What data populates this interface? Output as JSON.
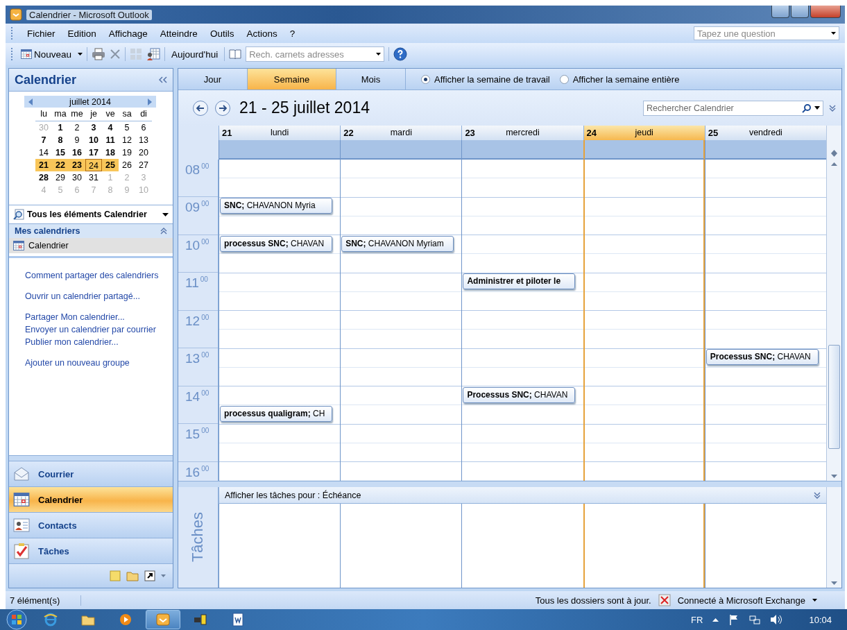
{
  "window": {
    "title": "Calendrier - Microsoft Outlook"
  },
  "menu": [
    "Fichier",
    "Edition",
    "Affichage",
    "Atteindre",
    "Outils",
    "Actions",
    "?"
  ],
  "help_box": {
    "placeholder": "Tapez une question"
  },
  "toolbar": {
    "new_label": "Nouveau",
    "today_label": "Aujourd'hui",
    "address_search": {
      "placeholder": "Rech. carnets adresses"
    }
  },
  "sidebar": {
    "title": "Calendrier",
    "mini_calendar": {
      "month": "juillet 2014",
      "weekdays": [
        "lu",
        "ma",
        "me",
        "je",
        "ve",
        "sa",
        "di"
      ],
      "weeks": [
        [
          {
            "day": "30",
            "bold": false,
            "outside": true,
            "selected": false,
            "today": false
          },
          {
            "day": "1",
            "bold": true,
            "outside": false,
            "selected": false,
            "today": false
          },
          {
            "day": "2",
            "bold": false,
            "outside": false,
            "selected": false,
            "today": false
          },
          {
            "day": "3",
            "bold": true,
            "outside": false,
            "selected": false,
            "today": false
          },
          {
            "day": "4",
            "bold": true,
            "outside": false,
            "selected": false,
            "today": false
          },
          {
            "day": "5",
            "bold": false,
            "outside": false,
            "selected": false,
            "today": false
          },
          {
            "day": "6",
            "bold": false,
            "outside": false,
            "selected": false,
            "today": false
          }
        ],
        [
          {
            "day": "7",
            "bold": true,
            "outside": false,
            "selected": false,
            "today": false
          },
          {
            "day": "8",
            "bold": true,
            "outside": false,
            "selected": false,
            "today": false
          },
          {
            "day": "9",
            "bold": false,
            "outside": false,
            "selected": false,
            "today": false
          },
          {
            "day": "10",
            "bold": true,
            "outside": false,
            "selected": false,
            "today": false
          },
          {
            "day": "11",
            "bold": true,
            "outside": false,
            "selected": false,
            "today": false
          },
          {
            "day": "12",
            "bold": false,
            "outside": false,
            "selected": false,
            "today": false
          },
          {
            "day": "13",
            "bold": false,
            "outside": false,
            "selected": false,
            "today": false
          }
        ],
        [
          {
            "day": "14",
            "bold": false,
            "outside": false,
            "selected": false,
            "today": false
          },
          {
            "day": "15",
            "bold": true,
            "outside": false,
            "selected": false,
            "today": false
          },
          {
            "day": "16",
            "bold": true,
            "outside": false,
            "selected": false,
            "today": false
          },
          {
            "day": "17",
            "bold": true,
            "outside": false,
            "selected": false,
            "today": false
          },
          {
            "day": "18",
            "bold": true,
            "outside": false,
            "selected": false,
            "today": false
          },
          {
            "day": "19",
            "bold": false,
            "outside": false,
            "selected": false,
            "today": false
          },
          {
            "day": "20",
            "bold": false,
            "outside": false,
            "selected": false,
            "today": false
          }
        ],
        [
          {
            "day": "21",
            "bold": true,
            "outside": false,
            "selected": true,
            "today": false
          },
          {
            "day": "22",
            "bold": true,
            "outside": false,
            "selected": true,
            "today": false
          },
          {
            "day": "23",
            "bold": true,
            "outside": false,
            "selected": true,
            "today": false
          },
          {
            "day": "24",
            "bold": false,
            "outside": false,
            "selected": true,
            "today": true
          },
          {
            "day": "25",
            "bold": true,
            "outside": false,
            "selected": true,
            "today": false
          },
          {
            "day": "26",
            "bold": false,
            "outside": false,
            "selected": false,
            "today": false
          },
          {
            "day": "27",
            "bold": false,
            "outside": false,
            "selected": false,
            "today": false
          }
        ],
        [
          {
            "day": "28",
            "bold": true,
            "outside": false,
            "selected": false,
            "today": false
          },
          {
            "day": "29",
            "bold": false,
            "outside": false,
            "selected": false,
            "today": false
          },
          {
            "day": "30",
            "bold": false,
            "outside": false,
            "selected": false,
            "today": false
          },
          {
            "day": "31",
            "bold": false,
            "outside": false,
            "selected": false,
            "today": false
          },
          {
            "day": "1",
            "bold": false,
            "outside": true,
            "selected": false,
            "today": false
          },
          {
            "day": "2",
            "bold": false,
            "outside": true,
            "selected": false,
            "today": false
          },
          {
            "day": "3",
            "bold": false,
            "outside": true,
            "selected": false,
            "today": false
          }
        ],
        [
          {
            "day": "4",
            "bold": false,
            "outside": true,
            "selected": false,
            "today": false
          },
          {
            "day": "5",
            "bold": false,
            "outside": true,
            "selected": false,
            "today": false
          },
          {
            "day": "6",
            "bold": false,
            "outside": true,
            "selected": false,
            "today": false
          },
          {
            "day": "7",
            "bold": false,
            "outside": true,
            "selected": false,
            "today": false
          },
          {
            "day": "8",
            "bold": false,
            "outside": true,
            "selected": false,
            "today": false
          },
          {
            "day": "9",
            "bold": false,
            "outside": true,
            "selected": false,
            "today": false
          },
          {
            "day": "10",
            "bold": false,
            "outside": true,
            "selected": false,
            "today": false
          }
        ]
      ]
    },
    "filter": "Tous les éléments Calendrier",
    "group": {
      "title": "Mes calendriers",
      "expanded": true,
      "items": [
        {
          "label": "Calendrier",
          "selected": true
        }
      ]
    },
    "links": [
      [
        "Comment partager des calendriers"
      ],
      [
        "Ouvrir un calendrier partagé..."
      ],
      [
        "Partager Mon calendrier...",
        "Envoyer un calendrier par courrier",
        "Publier mon calendrier..."
      ],
      [
        "Ajouter un nouveau groupe"
      ]
    ],
    "nav": [
      {
        "label": "Courrier",
        "kind": "mail",
        "selected": false
      },
      {
        "label": "Calendrier",
        "kind": "calendar",
        "selected": true
      },
      {
        "label": "Contacts",
        "kind": "contacts",
        "selected": false
      },
      {
        "label": "Tâches",
        "kind": "tasks",
        "selected": false
      }
    ]
  },
  "calendar": {
    "views": [
      {
        "label": "Jour",
        "selected": false
      },
      {
        "label": "Semaine",
        "selected": true
      },
      {
        "label": "Mois",
        "selected": false
      }
    ],
    "week_options": [
      {
        "label": "Afficher la semaine de travail",
        "selected": true
      },
      {
        "label": "Afficher la semaine entière",
        "selected": false
      }
    ],
    "title": "21 - 25 juillet 2014",
    "search": {
      "placeholder": "Rechercher Calendrier"
    },
    "days": [
      {
        "date": "21",
        "name": "lundi",
        "today": false
      },
      {
        "date": "22",
        "name": "mardi",
        "today": false
      },
      {
        "date": "23",
        "name": "mercredi",
        "today": false
      },
      {
        "date": "24",
        "name": "jeudi",
        "today": true
      },
      {
        "date": "25",
        "name": "vendredi",
        "today": false
      }
    ],
    "hours": [
      {
        "hour": "08",
        "minutes": "00",
        "cells": [
          {},
          {},
          {},
          {},
          {}
        ]
      },
      {
        "hour": "09",
        "minutes": "00",
        "cells": [
          {
            "event": "**SNC;** CHAVANON Myria"
          },
          {},
          {},
          {},
          {}
        ]
      },
      {
        "hour": "10",
        "minutes": "00",
        "cells": [
          {
            "event": "**processus SNC;** CHAVAN"
          },
          {
            "event": "**SNC;** CHAVANON Myriam"
          },
          {},
          {},
          {}
        ]
      },
      {
        "hour": "11",
        "minutes": "00",
        "cells": [
          {},
          {},
          {
            "event": "**Administrer et piloter le**"
          },
          {},
          {}
        ]
      },
      {
        "hour": "12",
        "minutes": "00",
        "cells": [
          {},
          {},
          {},
          {},
          {}
        ]
      },
      {
        "hour": "13",
        "minutes": "00",
        "cells": [
          {},
          {},
          {},
          {},
          {
            "event": "**Processus SNC;** CHAVAN"
          }
        ]
      },
      {
        "hour": "14",
        "minutes": "00",
        "cells": [
          {
            "half_past_event": "**processus qualigram;** CH"
          },
          {},
          {
            "event": "**Processus SNC;** CHAVAN"
          },
          {},
          {}
        ]
      },
      {
        "hour": "15",
        "minutes": "00",
        "cells": [
          {},
          {},
          {},
          {},
          {}
        ]
      },
      {
        "hour": "16",
        "minutes": "00",
        "cells": [
          {},
          {},
          {},
          {},
          {}
        ]
      }
    ],
    "tasks": {
      "label": "Afficher les tâches pour : Échéance",
      "title": "Tâches"
    }
  },
  "status_bar": {
    "count": "7 élément(s)",
    "sync": "Tous les dossiers sont à jour.",
    "connection": "Connecté à Microsoft Exchange"
  },
  "taskbar": {
    "apps": [
      {
        "kind": "browser",
        "active": false
      },
      {
        "kind": "folder",
        "active": false
      },
      {
        "kind": "media",
        "active": false
      },
      {
        "kind": "mail",
        "active": true
      },
      {
        "kind": "network",
        "active": false
      },
      {
        "kind": "document",
        "active": false
      }
    ],
    "language": "FR",
    "clock": "10:04"
  }
}
